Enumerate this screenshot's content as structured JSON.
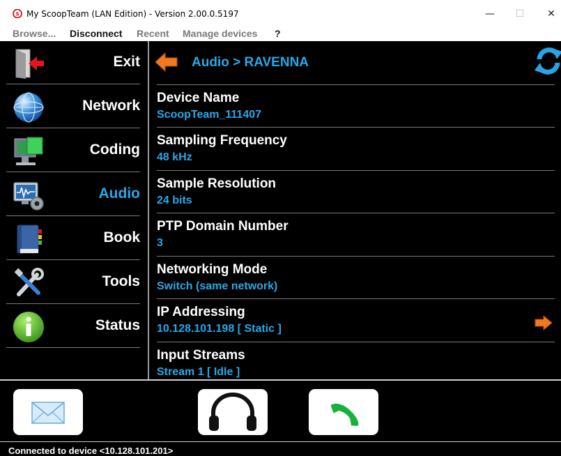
{
  "window": {
    "title": "My ScoopTeam (LAN Edition) - Version 2.00.0.5197",
    "minimize": "—",
    "maximize": "☐",
    "close": "✕"
  },
  "menu": {
    "items": [
      {
        "label": "Browse...",
        "active": false
      },
      {
        "label": "Disconnect",
        "active": true
      },
      {
        "label": "Recent",
        "active": false
      },
      {
        "label": "Manage devices",
        "active": false
      },
      {
        "label": "?",
        "active": true
      }
    ]
  },
  "sidebar": {
    "items": [
      {
        "label": "Exit",
        "icon": "exit-door-icon"
      },
      {
        "label": "Network",
        "icon": "globe-icon"
      },
      {
        "label": "Coding",
        "icon": "coding-press-icon"
      },
      {
        "label": "Audio",
        "icon": "audio-monitor-gear-icon",
        "active": true
      },
      {
        "label": "Book",
        "icon": "book-icon"
      },
      {
        "label": "Tools",
        "icon": "tools-icon"
      },
      {
        "label": "Status",
        "icon": "info-icon"
      }
    ]
  },
  "header": {
    "breadcrumb": "Audio > RAVENNA"
  },
  "settings": [
    {
      "title": "Device Name",
      "value": "ScoopTeam_111407"
    },
    {
      "title": "Sampling Frequency",
      "value": "48 kHz"
    },
    {
      "title": "Sample Resolution",
      "value": "24 bits"
    },
    {
      "title": "PTP Domain Number",
      "value": "3"
    },
    {
      "title": "Networking Mode",
      "value": "Switch (same network)"
    },
    {
      "title": "IP Addressing",
      "value": "10.128.101.198 [ Static ]",
      "has_arrow": true
    },
    {
      "title": "Input Streams",
      "value": "Stream 1 [ Idle ]"
    }
  ],
  "bottom_buttons": [
    {
      "name": "mail",
      "icon": "envelope-icon"
    },
    {
      "name": "headphones",
      "icon": "headphones-icon"
    },
    {
      "name": "call",
      "icon": "phone-icon"
    }
  ],
  "status": {
    "text": "Connected to device <10.128.101.201>"
  },
  "colors": {
    "accent": "#29a8e8",
    "arrow": "#f07820",
    "background": "#000000"
  }
}
